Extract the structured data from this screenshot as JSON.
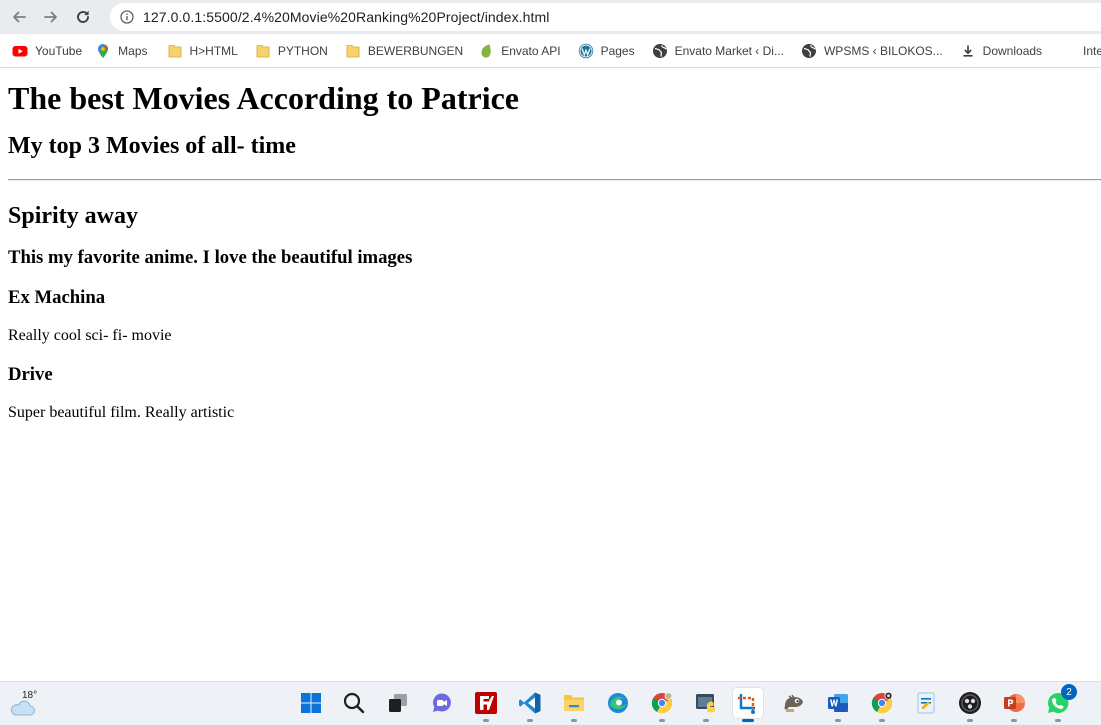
{
  "browser": {
    "url": "127.0.0.1:5500/2.4%20Movie%20Ranking%20Project/index.html",
    "bookmarks": [
      {
        "label": "YouTube",
        "icon": "youtube-icon"
      },
      {
        "label": "Maps",
        "icon": "maps-icon"
      },
      {
        "label": "H>HTML",
        "icon": "folder-icon"
      },
      {
        "label": "PYTHON",
        "icon": "folder-icon"
      },
      {
        "label": "BEWERBUNGEN",
        "icon": "folder-icon"
      },
      {
        "label": "Envato API",
        "icon": "envato-icon"
      },
      {
        "label": "Pages",
        "icon": "wordpress-icon"
      },
      {
        "label": "Envato Market ‹ Di...",
        "icon": "globe-icon"
      },
      {
        "label": "WPSMS ‹ BILOKOS...",
        "icon": "globe-icon"
      },
      {
        "label": "Downloads",
        "icon": "download-icon"
      },
      {
        "label": "Interpella",
        "icon": ""
      }
    ]
  },
  "page": {
    "title": "The best Movies According to Patrice",
    "subtitle": "My top 3 Movies of all- time",
    "movies": [
      {
        "title": "Spirity away",
        "description": "This my favorite anime. I love the beautiful images"
      },
      {
        "title": "Ex Machina",
        "description": "Really cool sci- fi- movie"
      },
      {
        "title": "Drive",
        "description": "Super beautiful film. Really artistic"
      }
    ]
  },
  "taskbar": {
    "weather_temp": "18°",
    "whatsapp_badge": "2",
    "apps": [
      "start-icon",
      "search-icon",
      "task-view-icon",
      "chat-icon",
      "filezilla-icon",
      "vscode-icon",
      "file-explorer-icon",
      "edge-icon",
      "chrome-icon",
      "python-app-icon",
      "snipping-tool-icon",
      "gimp-icon",
      "word-icon",
      "chrome-alt-icon",
      "notepad-icon",
      "obs-icon",
      "powerpoint-icon",
      "whatsapp-icon"
    ]
  },
  "colors": {
    "chrome_bg": "#e8ecef",
    "taskbar_bg": "#eef2f7",
    "accent": "#0067c0"
  }
}
